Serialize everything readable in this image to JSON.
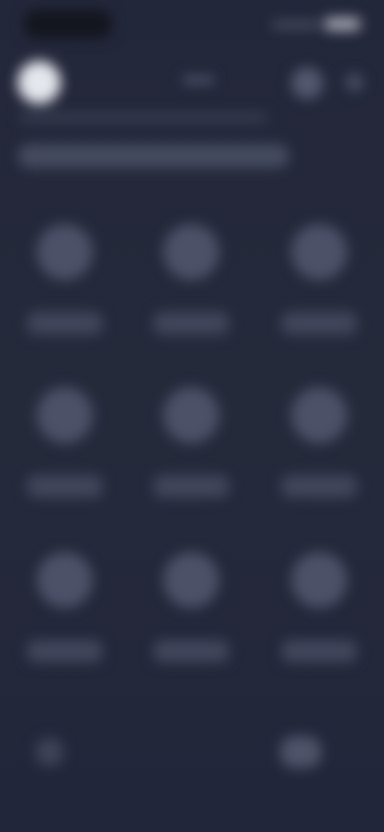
{
  "colors": {
    "background": "#242838",
    "avatar": "#e5e7ee",
    "tile": "#4c5168"
  },
  "header": {
    "avatar_icon": "avatar-icon",
    "action_icons": [
      "circle-icon",
      "circle-icon"
    ]
  },
  "grid": {
    "rows": 3,
    "columns": 3,
    "tiles": [
      {
        "icon": "app-icon"
      },
      {
        "icon": "app-icon"
      },
      {
        "icon": "app-icon"
      },
      {
        "icon": "app-icon"
      },
      {
        "icon": "app-icon"
      },
      {
        "icon": "app-icon"
      },
      {
        "icon": "app-icon"
      },
      {
        "icon": "app-icon"
      },
      {
        "icon": "app-icon"
      }
    ]
  },
  "bottom_bar": {
    "icons": [
      "nav-icon",
      "nav-icon"
    ]
  }
}
